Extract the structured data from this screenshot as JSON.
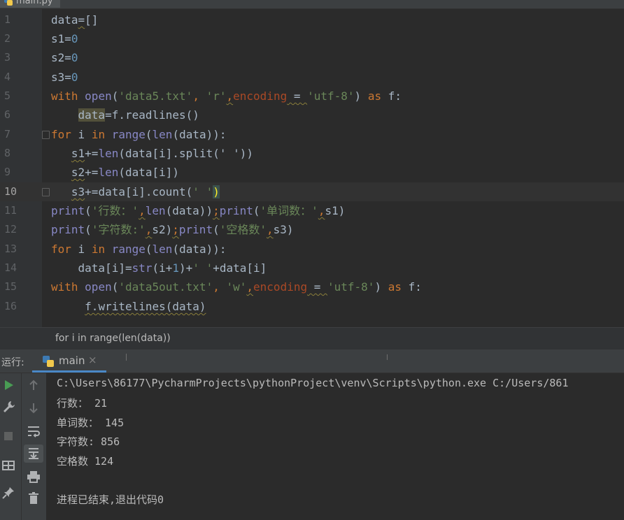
{
  "editor_tab": {
    "label": "main.py"
  },
  "line_numbers": [
    "1",
    "2",
    "3",
    "4",
    "5",
    "6",
    "7",
    "8",
    "9",
    "10",
    "11",
    "12",
    "13",
    "14",
    "15",
    "16"
  ],
  "code": {
    "l1_name": "data",
    "l1_rest": "[]",
    "l2_name": "s1",
    "l3_name": "s2",
    "l4_name": "s3",
    "zero": "0",
    "kw_with": "with",
    "kw_as": "as",
    "kw_for": "for",
    "kw_in": "in",
    "open": "open",
    "range": "range",
    "len": "len",
    "print": "print",
    "str": "str",
    "file_in": "'data5.txt'",
    "mode_r": "'r'",
    "encoding": "encoding",
    "utf8": "'utf-8'",
    "f": "f",
    "readlines": "f.readlines()",
    "split_call": "(data[i].split(' '))",
    "count_call": "data[i].count(",
    "count_arg": "' '",
    "str_lines": "'行数：'",
    "str_words": "'单词数：'",
    "str_chars": "'字符数:'",
    "str_spaces": "'空格数'",
    "file_out": "'data5out.txt'",
    "mode_w": "'w'",
    "space_str": "' '",
    "writelines": "f.writelines(data)"
  },
  "breadcrumb": {
    "text": "for i in range(len(data))"
  },
  "run_panel": {
    "label": "运行:",
    "tab_label": "main",
    "close": "×"
  },
  "console": {
    "lines": [
      "C:\\Users\\86177\\PycharmProjects\\pythonProject\\venv\\Scripts\\python.exe C:/Users/861",
      "行数： 21",
      "单词数： 145",
      "字符数: 856",
      "空格数 124",
      "",
      "进程已结束,退出代码0"
    ]
  },
  "icons": {
    "left_toolbar": [
      "run-icon",
      "wrench-icon",
      "stop-icon",
      "layout-icon",
      "pin-icon"
    ],
    "right_toolbar": [
      "arrow-up-icon",
      "arrow-down-icon",
      "soft-wrap-icon",
      "scroll-to-end-icon",
      "print-icon",
      "trash-icon"
    ]
  },
  "colors": {
    "keyword": "#cc7832",
    "string": "#6a8759",
    "number": "#6897bb",
    "builtin": "#8888c6",
    "kwarg": "#aa4926",
    "text": "#a9b7c6",
    "run_green": "#499c54",
    "accent_blue": "#4a88c7"
  }
}
